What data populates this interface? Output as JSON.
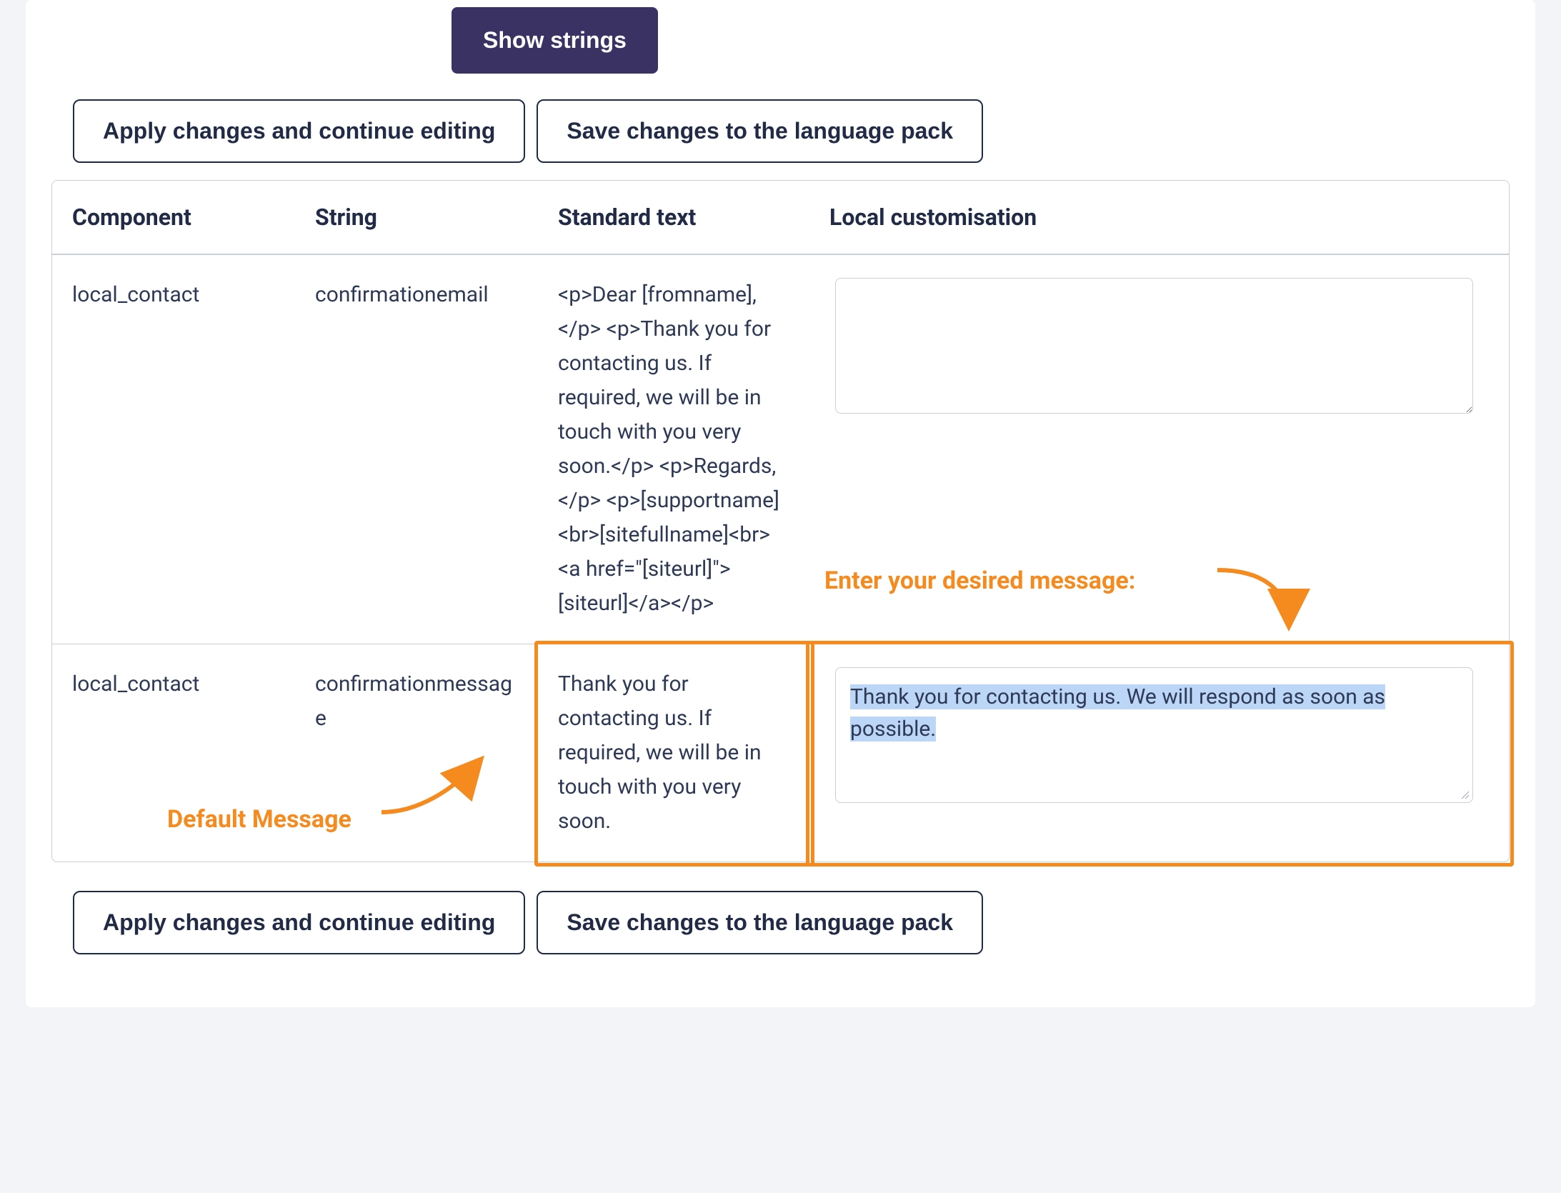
{
  "buttons": {
    "show_strings": "Show strings",
    "apply_top": "Apply changes and continue editing",
    "save_top": "Save changes to the language pack",
    "apply_bottom": "Apply changes and continue editing",
    "save_bottom": "Save changes to the language pack"
  },
  "table": {
    "headers": {
      "component": "Component",
      "string": "String",
      "standard": "Standard text",
      "local": "Local customisation"
    },
    "rows": [
      {
        "component": "local_contact",
        "string_id": "confirmationemail",
        "standard_text": "<p>Dear [fromname],</p> <p>Thank you for contacting us. If required, we will be in touch with you very soon.</p> <p>Regards,</p> <p>[supportname]<br>[sitefullname]<br><a href=\"[siteurl]\">[siteurl]</a></p>",
        "local_value": ""
      },
      {
        "component": "local_contact",
        "string_id": "confirmationmessage",
        "standard_text": "Thank you for contacting us. If required, we will be in touch with you very soon.",
        "local_value": "Thank you for contacting us. We will respond as soon as possible."
      }
    ]
  },
  "annotations": {
    "default_message": "Default Message",
    "enter_message": "Enter your desired message:"
  }
}
